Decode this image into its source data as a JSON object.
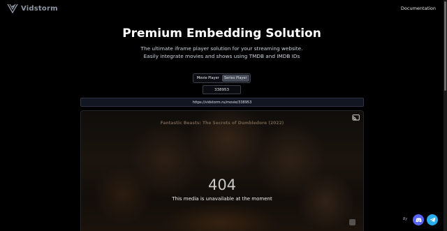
{
  "header": {
    "brand": "Vidstorm",
    "nav_documentation": "Documentation"
  },
  "hero": {
    "title": "Premium Embedding Solution",
    "subtitle": "The ultimate iframe player solution for your streaming website. Easily integrate movies and shows using TMDB and IMDB IDs"
  },
  "player_toggle": {
    "options": [
      "Movie Player",
      "Series Player"
    ],
    "active_index": 1
  },
  "id_input": {
    "value": "338953"
  },
  "embed_url": "https://vidstorm.ru/movie/338953",
  "player": {
    "poster_title": "Fantastic Beasts: The Secrets of Dumbledore (2022)",
    "error_code": "404",
    "error_message": "This media is unavailable at the moment"
  },
  "floating": {
    "label": "By",
    "icons": [
      "discord-icon",
      "telegram-icon"
    ],
    "discord_color": "#5865f2",
    "telegram_color": "#2aabee"
  },
  "colors": {
    "background": "#000000",
    "brand_text": "#8f96a3",
    "accent_active_toggle": "#454b57"
  }
}
